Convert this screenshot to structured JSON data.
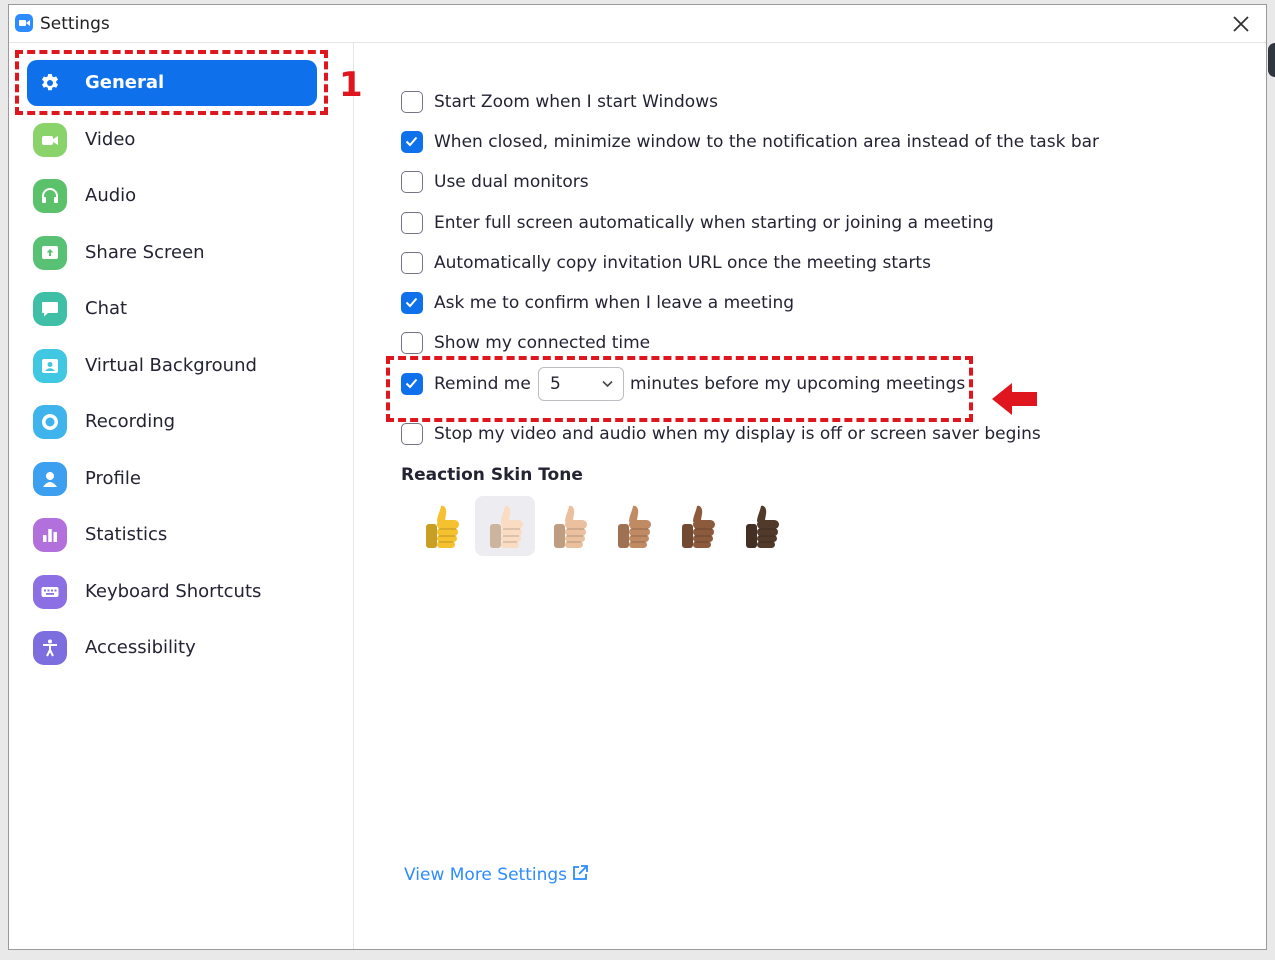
{
  "window": {
    "title": "Settings"
  },
  "sidebar": {
    "items": [
      {
        "label": "General",
        "icon": "gear-icon",
        "color": "#0e71eb"
      },
      {
        "label": "Video",
        "icon": "video-camera-icon",
        "color": "#8ad26a"
      },
      {
        "label": "Audio",
        "icon": "headphones-icon",
        "color": "#5cc16b"
      },
      {
        "label": "Share Screen",
        "icon": "share-screen-icon",
        "color": "#58c173"
      },
      {
        "label": "Chat",
        "icon": "chat-bubble-icon",
        "color": "#3fbfa6"
      },
      {
        "label": "Virtual Background",
        "icon": "virtual-background-icon",
        "color": "#40c7e1"
      },
      {
        "label": "Recording",
        "icon": "record-icon",
        "color": "#3fb4ec"
      },
      {
        "label": "Profile",
        "icon": "person-icon",
        "color": "#3c9ff0"
      },
      {
        "label": "Statistics",
        "icon": "bar-chart-icon",
        "color": "#b270dc"
      },
      {
        "label": "Keyboard Shortcuts",
        "icon": "keyboard-icon",
        "color": "#8b6fe3"
      },
      {
        "label": "Accessibility",
        "icon": "accessibility-icon",
        "color": "#7d6ee0"
      }
    ],
    "active_index": 0
  },
  "annotation": {
    "step_number": "1",
    "highlight_color": "#e0161e"
  },
  "general": {
    "options": [
      {
        "label": "Start Zoom when I start Windows",
        "checked": false
      },
      {
        "label": "When closed, minimize window to the notification area instead of the task bar",
        "checked": true
      },
      {
        "label": "Use dual monitors",
        "checked": false
      },
      {
        "label": "Enter full screen automatically when starting or joining a meeting",
        "checked": false
      },
      {
        "label": "Automatically copy invitation URL once the meeting starts",
        "checked": false
      },
      {
        "label": "Ask me to confirm when I leave a meeting",
        "checked": true
      },
      {
        "label": "Show my connected time",
        "checked": false
      }
    ],
    "reminder": {
      "checked": true,
      "prefix": "Remind me",
      "selected_minutes": "5",
      "suffix": "minutes before my upcoming meetings"
    },
    "screensaver_option": {
      "label": "Stop my video and audio when my display is off or screen saver begins",
      "checked": false
    },
    "skin_tone": {
      "title": "Reaction Skin Tone",
      "tones": [
        "#f5c12e",
        "#f9dcc2",
        "#eac09e",
        "#c08a63",
        "#8c5b3d",
        "#523a2b"
      ],
      "selected_index": 1
    },
    "more_settings_link": "View More Settings"
  },
  "colors": {
    "accent": "#0e71eb",
    "link": "#2d8cff"
  }
}
